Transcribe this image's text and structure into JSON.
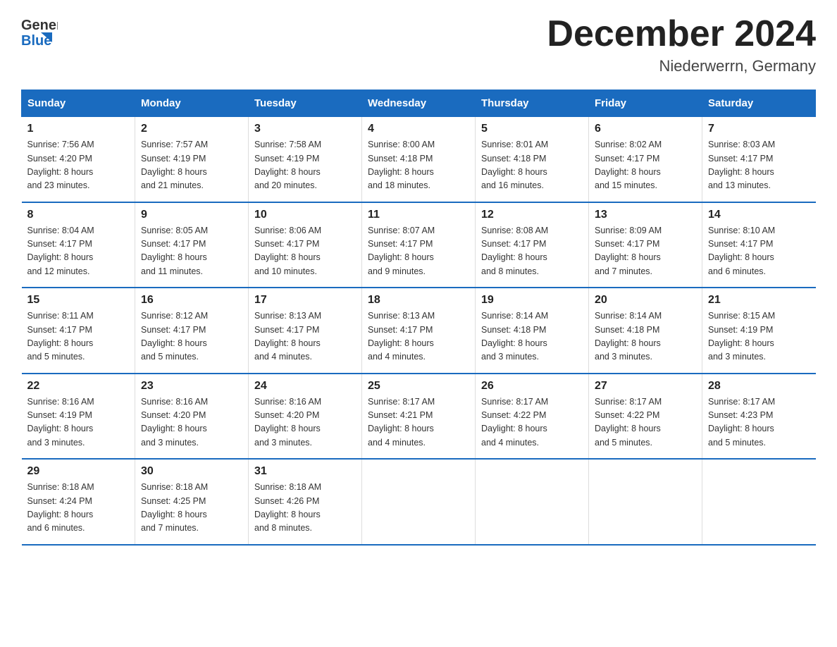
{
  "header": {
    "logo_text_general": "General",
    "logo_text_blue": "Blue",
    "month_title": "December 2024",
    "location": "Niederwerrn, Germany"
  },
  "weekdays": [
    "Sunday",
    "Monday",
    "Tuesday",
    "Wednesday",
    "Thursday",
    "Friday",
    "Saturday"
  ],
  "weeks": [
    [
      {
        "day": "1",
        "sunrise": "Sunrise: 7:56 AM",
        "sunset": "Sunset: 4:20 PM",
        "daylight": "Daylight: 8 hours and 23 minutes."
      },
      {
        "day": "2",
        "sunrise": "Sunrise: 7:57 AM",
        "sunset": "Sunset: 4:19 PM",
        "daylight": "Daylight: 8 hours and 21 minutes."
      },
      {
        "day": "3",
        "sunrise": "Sunrise: 7:58 AM",
        "sunset": "Sunset: 4:19 PM",
        "daylight": "Daylight: 8 hours and 20 minutes."
      },
      {
        "day": "4",
        "sunrise": "Sunrise: 8:00 AM",
        "sunset": "Sunset: 4:18 PM",
        "daylight": "Daylight: 8 hours and 18 minutes."
      },
      {
        "day": "5",
        "sunrise": "Sunrise: 8:01 AM",
        "sunset": "Sunset: 4:18 PM",
        "daylight": "Daylight: 8 hours and 16 minutes."
      },
      {
        "day": "6",
        "sunrise": "Sunrise: 8:02 AM",
        "sunset": "Sunset: 4:17 PM",
        "daylight": "Daylight: 8 hours and 15 minutes."
      },
      {
        "day": "7",
        "sunrise": "Sunrise: 8:03 AM",
        "sunset": "Sunset: 4:17 PM",
        "daylight": "Daylight: 8 hours and 13 minutes."
      }
    ],
    [
      {
        "day": "8",
        "sunrise": "Sunrise: 8:04 AM",
        "sunset": "Sunset: 4:17 PM",
        "daylight": "Daylight: 8 hours and 12 minutes."
      },
      {
        "day": "9",
        "sunrise": "Sunrise: 8:05 AM",
        "sunset": "Sunset: 4:17 PM",
        "daylight": "Daylight: 8 hours and 11 minutes."
      },
      {
        "day": "10",
        "sunrise": "Sunrise: 8:06 AM",
        "sunset": "Sunset: 4:17 PM",
        "daylight": "Daylight: 8 hours and 10 minutes."
      },
      {
        "day": "11",
        "sunrise": "Sunrise: 8:07 AM",
        "sunset": "Sunset: 4:17 PM",
        "daylight": "Daylight: 8 hours and 9 minutes."
      },
      {
        "day": "12",
        "sunrise": "Sunrise: 8:08 AM",
        "sunset": "Sunset: 4:17 PM",
        "daylight": "Daylight: 8 hours and 8 minutes."
      },
      {
        "day": "13",
        "sunrise": "Sunrise: 8:09 AM",
        "sunset": "Sunset: 4:17 PM",
        "daylight": "Daylight: 8 hours and 7 minutes."
      },
      {
        "day": "14",
        "sunrise": "Sunrise: 8:10 AM",
        "sunset": "Sunset: 4:17 PM",
        "daylight": "Daylight: 8 hours and 6 minutes."
      }
    ],
    [
      {
        "day": "15",
        "sunrise": "Sunrise: 8:11 AM",
        "sunset": "Sunset: 4:17 PM",
        "daylight": "Daylight: 8 hours and 5 minutes."
      },
      {
        "day": "16",
        "sunrise": "Sunrise: 8:12 AM",
        "sunset": "Sunset: 4:17 PM",
        "daylight": "Daylight: 8 hours and 5 minutes."
      },
      {
        "day": "17",
        "sunrise": "Sunrise: 8:13 AM",
        "sunset": "Sunset: 4:17 PM",
        "daylight": "Daylight: 8 hours and 4 minutes."
      },
      {
        "day": "18",
        "sunrise": "Sunrise: 8:13 AM",
        "sunset": "Sunset: 4:17 PM",
        "daylight": "Daylight: 8 hours and 4 minutes."
      },
      {
        "day": "19",
        "sunrise": "Sunrise: 8:14 AM",
        "sunset": "Sunset: 4:18 PM",
        "daylight": "Daylight: 8 hours and 3 minutes."
      },
      {
        "day": "20",
        "sunrise": "Sunrise: 8:14 AM",
        "sunset": "Sunset: 4:18 PM",
        "daylight": "Daylight: 8 hours and 3 minutes."
      },
      {
        "day": "21",
        "sunrise": "Sunrise: 8:15 AM",
        "sunset": "Sunset: 4:19 PM",
        "daylight": "Daylight: 8 hours and 3 minutes."
      }
    ],
    [
      {
        "day": "22",
        "sunrise": "Sunrise: 8:16 AM",
        "sunset": "Sunset: 4:19 PM",
        "daylight": "Daylight: 8 hours and 3 minutes."
      },
      {
        "day": "23",
        "sunrise": "Sunrise: 8:16 AM",
        "sunset": "Sunset: 4:20 PM",
        "daylight": "Daylight: 8 hours and 3 minutes."
      },
      {
        "day": "24",
        "sunrise": "Sunrise: 8:16 AM",
        "sunset": "Sunset: 4:20 PM",
        "daylight": "Daylight: 8 hours and 3 minutes."
      },
      {
        "day": "25",
        "sunrise": "Sunrise: 8:17 AM",
        "sunset": "Sunset: 4:21 PM",
        "daylight": "Daylight: 8 hours and 4 minutes."
      },
      {
        "day": "26",
        "sunrise": "Sunrise: 8:17 AM",
        "sunset": "Sunset: 4:22 PM",
        "daylight": "Daylight: 8 hours and 4 minutes."
      },
      {
        "day": "27",
        "sunrise": "Sunrise: 8:17 AM",
        "sunset": "Sunset: 4:22 PM",
        "daylight": "Daylight: 8 hours and 5 minutes."
      },
      {
        "day": "28",
        "sunrise": "Sunrise: 8:17 AM",
        "sunset": "Sunset: 4:23 PM",
        "daylight": "Daylight: 8 hours and 5 minutes."
      }
    ],
    [
      {
        "day": "29",
        "sunrise": "Sunrise: 8:18 AM",
        "sunset": "Sunset: 4:24 PM",
        "daylight": "Daylight: 8 hours and 6 minutes."
      },
      {
        "day": "30",
        "sunrise": "Sunrise: 8:18 AM",
        "sunset": "Sunset: 4:25 PM",
        "daylight": "Daylight: 8 hours and 7 minutes."
      },
      {
        "day": "31",
        "sunrise": "Sunrise: 8:18 AM",
        "sunset": "Sunset: 4:26 PM",
        "daylight": "Daylight: 8 hours and 8 minutes."
      },
      null,
      null,
      null,
      null
    ]
  ]
}
